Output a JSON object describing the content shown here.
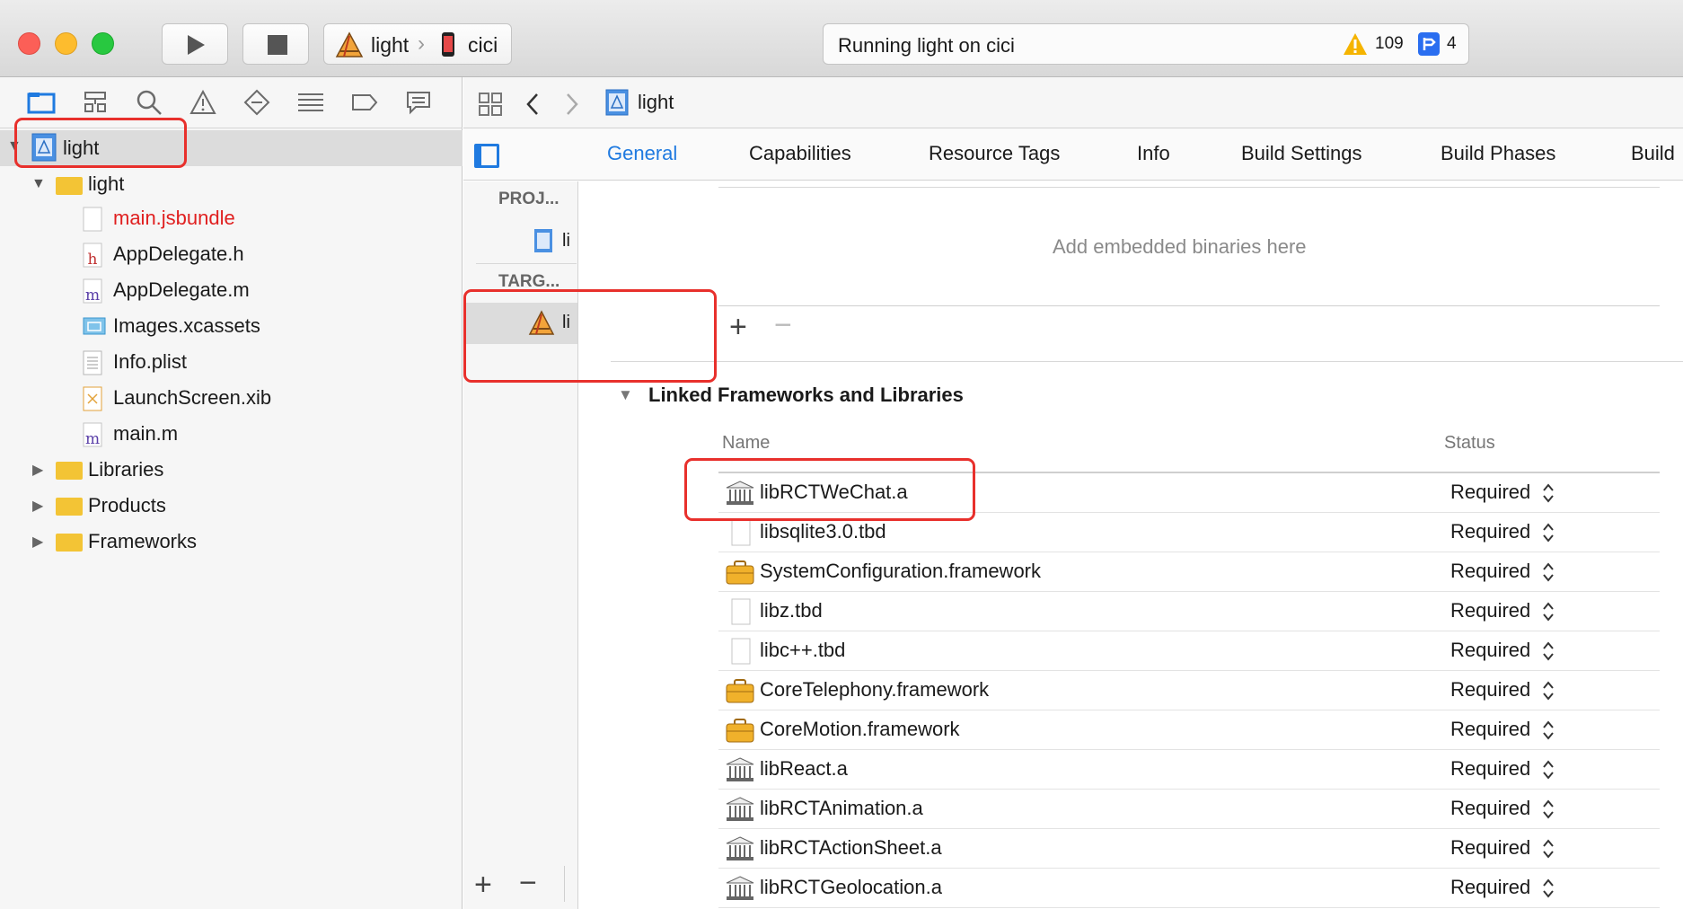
{
  "toolbar": {
    "scheme_name": "light",
    "device_name": "cici",
    "activity_text": "Running light on cici",
    "warning_count": "109",
    "issue_count": "4"
  },
  "navigator": {
    "project_name": "light",
    "group_name": "light",
    "files": [
      {
        "name": "main.jsbundle",
        "type": "jsbundle",
        "color": "#e01f1f"
      },
      {
        "name": "AppDelegate.h",
        "type": "h"
      },
      {
        "name": "AppDelegate.m",
        "type": "m"
      },
      {
        "name": "Images.xcassets",
        "type": "xcassets"
      },
      {
        "name": "Info.plist",
        "type": "plist"
      },
      {
        "name": "LaunchScreen.xib",
        "type": "xib"
      },
      {
        "name": "main.m",
        "type": "m"
      }
    ],
    "groups": [
      "Libraries",
      "Products",
      "Frameworks"
    ]
  },
  "editor": {
    "breadcrumb": "light",
    "tabs": [
      "General",
      "Capabilities",
      "Resource Tags",
      "Info",
      "Build Settings",
      "Build Phases",
      "Build"
    ],
    "active_tab": "General",
    "project_header": "PROJ...",
    "targets_header": "TARG...",
    "project_item": "li",
    "target_item": "li",
    "embedded_placeholder": "Add embedded binaries here",
    "section_title": "Linked Frameworks and Libraries",
    "col_name": "Name",
    "col_status": "Status",
    "libraries": [
      {
        "name": "libRCTWeChat.a",
        "kind": "lib",
        "status": "Required"
      },
      {
        "name": "libsqlite3.0.tbd",
        "kind": "tbd",
        "status": "Required"
      },
      {
        "name": "SystemConfiguration.framework",
        "kind": "framework",
        "status": "Required"
      },
      {
        "name": "libz.tbd",
        "kind": "tbd",
        "status": "Required"
      },
      {
        "name": "libc++.tbd",
        "kind": "tbd",
        "status": "Required"
      },
      {
        "name": "CoreTelephony.framework",
        "kind": "framework",
        "status": "Required"
      },
      {
        "name": "CoreMotion.framework",
        "kind": "framework",
        "status": "Required"
      },
      {
        "name": "libReact.a",
        "kind": "lib",
        "status": "Required"
      },
      {
        "name": "libRCTAnimation.a",
        "kind": "lib",
        "status": "Required"
      },
      {
        "name": "libRCTActionSheet.a",
        "kind": "lib",
        "status": "Required"
      },
      {
        "name": "libRCTGeolocation.a",
        "kind": "lib",
        "status": "Required"
      }
    ]
  },
  "colors": {
    "accent": "#1f7ae0",
    "annotation": "#e8302c",
    "red_close": "#fc5f57",
    "yellow_min": "#fdbc2e",
    "green_max": "#28c840"
  },
  "icons": [
    "play-icon",
    "stop-icon",
    "warning-icon",
    "issue-icon",
    "folder-icon",
    "library-icon",
    "framework-icon",
    "file-icon"
  ]
}
